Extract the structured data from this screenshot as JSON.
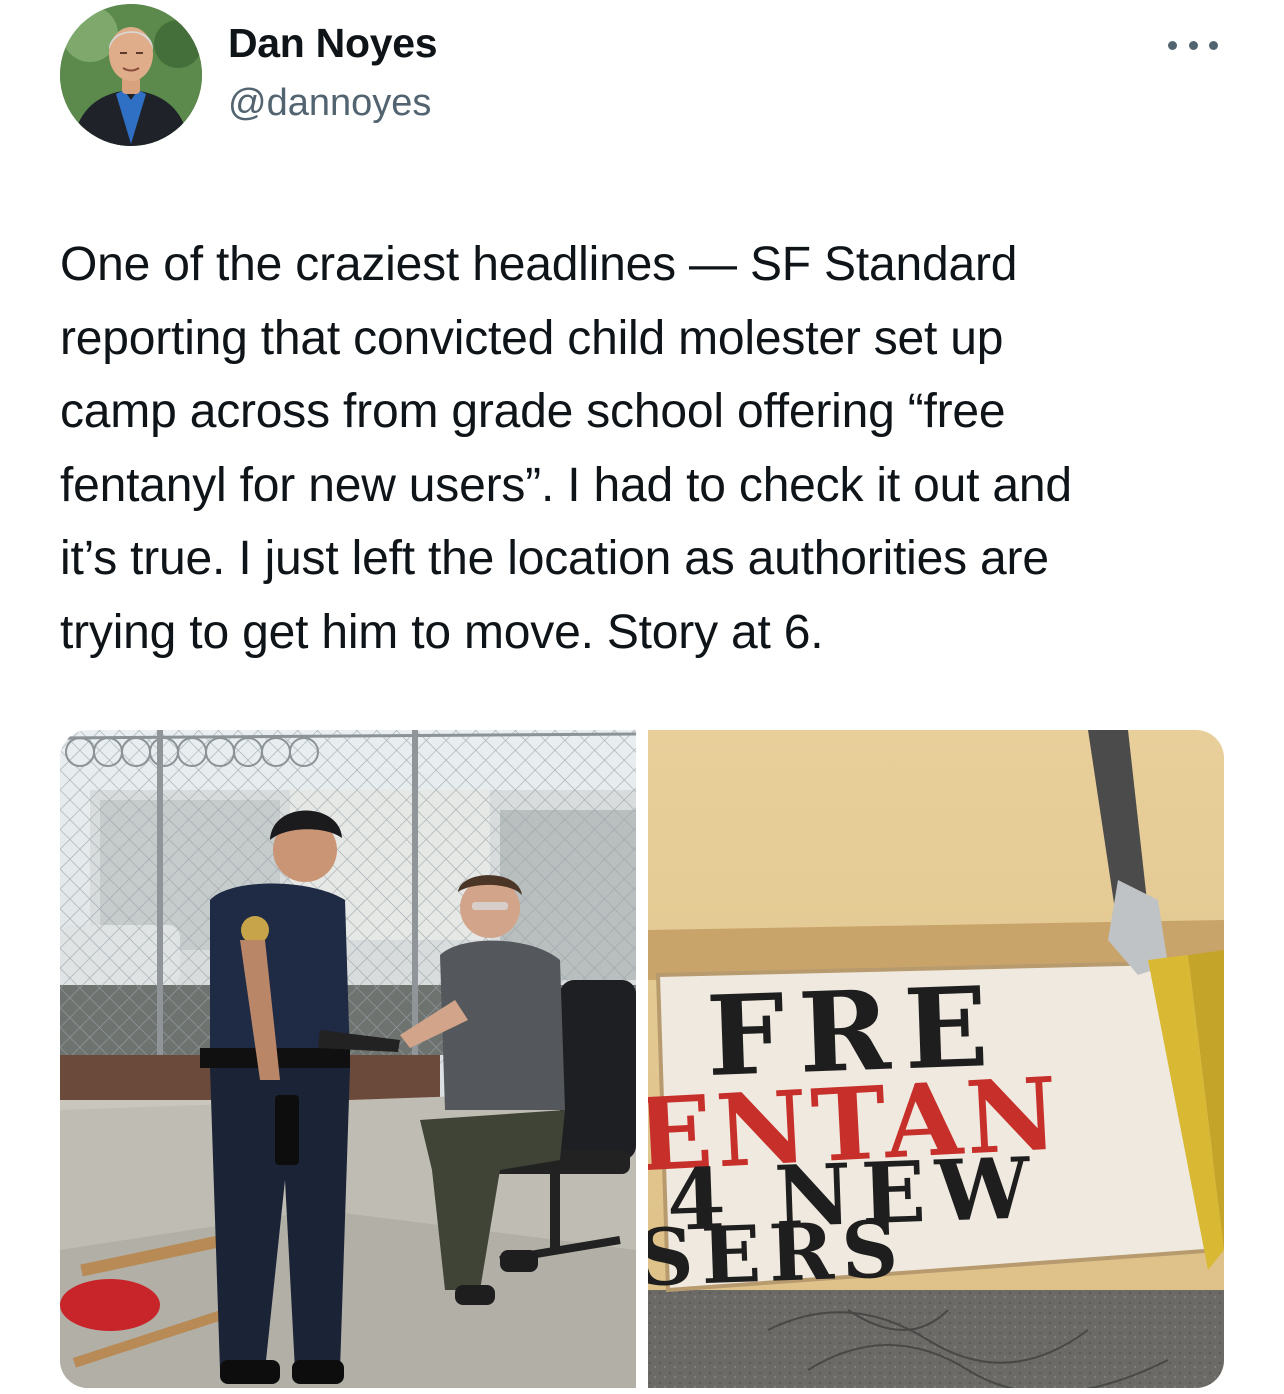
{
  "author": {
    "display_name": "Dan Noyes",
    "handle": "@dannoyes",
    "avatar_icon": "profile-photo"
  },
  "menu": {
    "more_icon": "more-horizontal-icon"
  },
  "tweet": {
    "text": "One of the craziest headlines — SF Standard\nreporting that convicted child molester set up\ncamp across from grade school offering “free\nfentanyl for new users”. I had to check it out and\nit’s true. I just left the location as authorities are\ntrying to get him to move. Story at 6."
  },
  "media": {
    "photo_1": {
      "subject": "police officer speaking with seated man by chain-link fence"
    },
    "photo_2": {
      "sign_lines": [
        "FRE",
        "ENTAN",
        "4 NEW",
        "SERS"
      ]
    }
  },
  "colors": {
    "text_primary": "#0f1419",
    "text_secondary": "#536471",
    "sign_red": "#c7302a",
    "sign_black": "#1e1e1e"
  }
}
